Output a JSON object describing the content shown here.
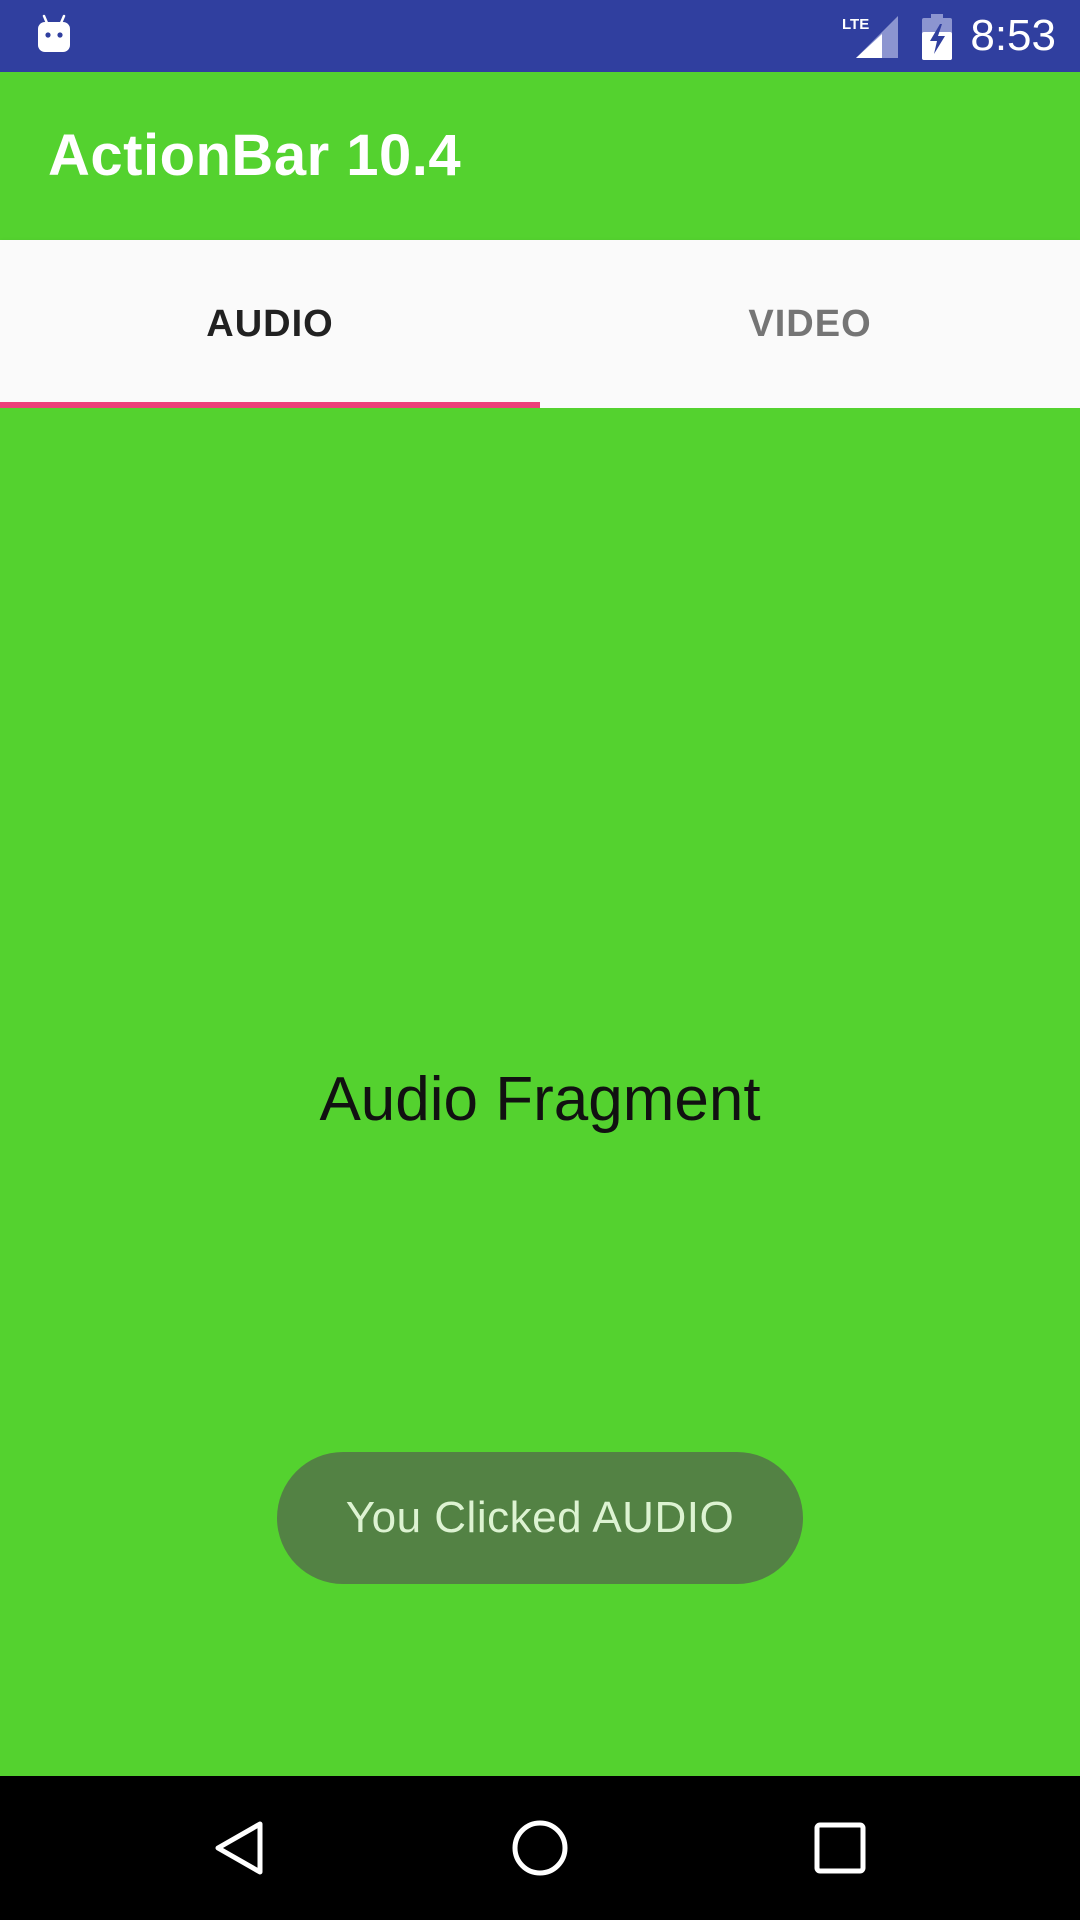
{
  "status_bar": {
    "time": "8:53",
    "icons": [
      "android-notification-icon",
      "lte-signal-icon",
      "battery-charging-icon"
    ],
    "background": "#303F9F"
  },
  "app_bar": {
    "title": "ActionBar 10.4",
    "background": "#54D22F"
  },
  "tabs": {
    "items": [
      {
        "label": "AUDIO",
        "selected": true
      },
      {
        "label": "VIDEO",
        "selected": false
      }
    ],
    "indicator_color": "#EC407A"
  },
  "content": {
    "fragment_text": "Audio Fragment",
    "background": "#54D22F"
  },
  "toast": {
    "message": "You Clicked AUDIO"
  },
  "nav_bar": {
    "icons": [
      "back-icon",
      "home-icon",
      "recents-icon"
    ]
  }
}
